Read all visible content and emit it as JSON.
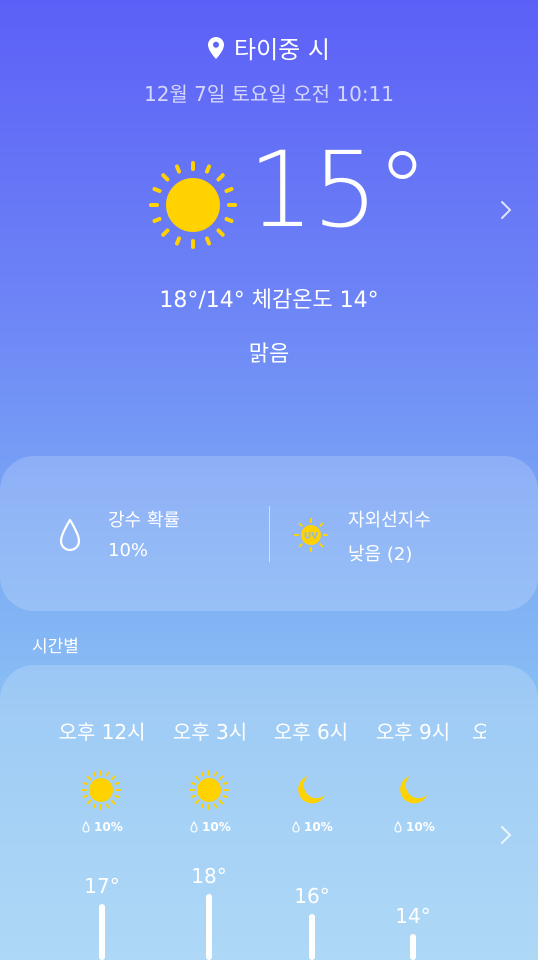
{
  "location": {
    "name": "타이중 시",
    "icon": "location-pin-icon"
  },
  "datetime": "12월 7일 토요일 오전 10:11",
  "current": {
    "temperature": "15°",
    "high_low_feels": "18°/14° 체감온도 14°",
    "condition": "맑음",
    "icon": "sun-icon"
  },
  "details": {
    "precipitation": {
      "label": "강수 확률",
      "value": "10%",
      "icon": "raindrop-icon"
    },
    "uv": {
      "label": "자외선지수",
      "value": "낮음 (2)",
      "icon": "uv-sun-icon"
    }
  },
  "hourly": {
    "title": "시간별",
    "items": [
      {
        "time": "오후 12시",
        "icon": "sun-icon",
        "pop": "10%",
        "temp": "17°",
        "temp_value": 17
      },
      {
        "time": "오후 3시",
        "icon": "sun-icon",
        "pop": "10%",
        "temp": "18°",
        "temp_value": 18
      },
      {
        "time": "오후 6시",
        "icon": "moon-icon",
        "pop": "10%",
        "temp": "16°",
        "temp_value": 16
      },
      {
        "time": "오후 9시",
        "icon": "moon-icon",
        "pop": "10%",
        "temp": "14°",
        "temp_value": 14
      }
    ],
    "next_partial": "오"
  },
  "colors": {
    "sun": "#ffd200",
    "bg_top": "#5c60f7",
    "bg_bottom": "#9dd0f4"
  }
}
